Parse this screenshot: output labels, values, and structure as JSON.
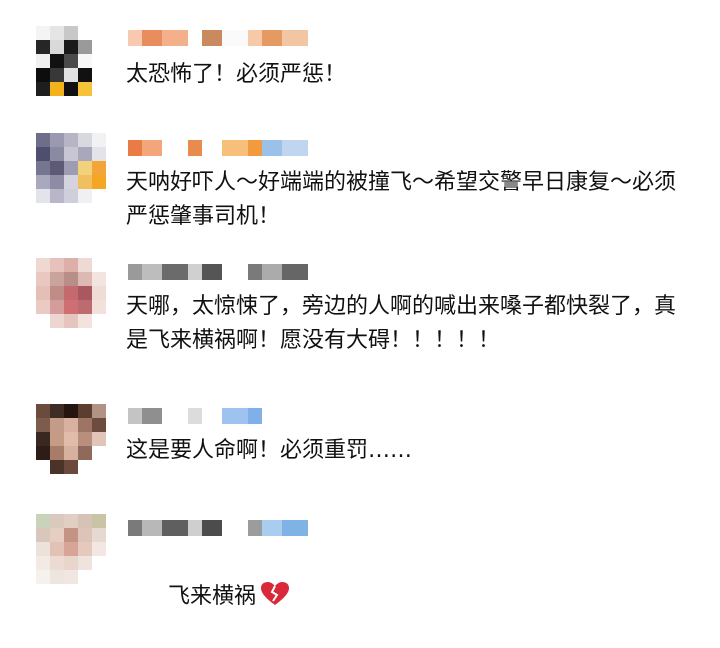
{
  "comments": [
    {
      "text": "太恐怖了！必须严惩！",
      "avatar_colors": [
        "#f4f4f4",
        "#e5e5e5",
        "#c8c8c8",
        "#ffffff",
        "#ffffff",
        "#262626",
        "#d9d9d9",
        "#1a1a1a",
        "#9a9a9a",
        "#ffffff",
        "#f0f0f0",
        "#111111",
        "#4a4a4a",
        "#f7f7f7",
        "#ffffff",
        "#0d0d0d",
        "#383838",
        "#e1e1e1",
        "#111111",
        "#ffffff",
        "#1e1e1e",
        "#f2b21c",
        "#111111",
        "#f5c33a",
        "#ffffff"
      ],
      "name_colors": [
        "#f6c9b0",
        "#e88d5e",
        "#f3b08a",
        "#ffffff",
        "#c98a60",
        "#fafafa",
        "#f7c9a8",
        "#e59a63",
        "#f2c6a3"
      ]
    },
    {
      "text": "天呐好吓人～好端端的被撞飞～希望交警早日康复～必须严惩肇事司机！",
      "avatar_colors": [
        "#6e6d8a",
        "#9a99b0",
        "#b7b5c5",
        "#d8d8df",
        "#f2f2f4",
        "#4f4e6e",
        "#8a8ba2",
        "#c7c6d2",
        "#a9a8bb",
        "#e3e3e9",
        "#777691",
        "#5c5a75",
        "#9d9cb3",
        "#f1d27a",
        "#f3a637",
        "#a9a9bd",
        "#8e8ca4",
        "#d5d4de",
        "#f0c060",
        "#f5a623",
        "#e3e3ea",
        "#b8b6c8",
        "#cfcedb",
        "#f0f0f3",
        "#ffffff"
      ],
      "name_colors": [
        "#e97c45",
        "#f4a67b",
        "#ffffff",
        "#e98b4c",
        "#ffffff",
        "#f6c07a",
        "#f19b3e",
        "#9bc1ea",
        "#c0d6f0"
      ]
    },
    {
      "text": "天哪，太惊悚了，旁边的人啊的喊出来嗓子都快裂了，真是飞来横祸啊！愿没有大碍！！！！！",
      "avatar_colors": [
        "#f0d8d2",
        "#e6c2ba",
        "#dcb0a8",
        "#efd9d4",
        "#ffffff",
        "#e8c8c0",
        "#caa39c",
        "#b88f88",
        "#dcbab3",
        "#f4e4e0",
        "#e4bfb6",
        "#c08c86",
        "#c46a6e",
        "#a95860",
        "#f0dcd7",
        "#e9cbc4",
        "#d49c9a",
        "#cf6e73",
        "#bd6b70",
        "#f2e0db",
        "#ffffff",
        "#eed6d0",
        "#e5c5be",
        "#f3e2de",
        "#ffffff"
      ],
      "name_colors": [
        "#9a9a9a",
        "#bdbdbd",
        "#6b6b6b",
        "#d0d0d0",
        "#555555",
        "#ffffff",
        "#7a7a7a",
        "#ababab",
        "#666666"
      ]
    },
    {
      "text": "这是要人命啊！必须重罚……",
      "avatar_colors": [
        "#6b4c3c",
        "#3f2c24",
        "#24160f",
        "#5a3e30",
        "#b29383",
        "#7e5c4b",
        "#c49a88",
        "#d8b1a1",
        "#9e7564",
        "#6d4c3e",
        "#3a2720",
        "#c69b86",
        "#e1bcaa",
        "#b78f7c",
        "#e0c5b8",
        "#2d1d16",
        "#a77c68",
        "#d7b19f",
        "#8f6a5a",
        "#ffffff",
        "#ffffff",
        "#4a3329",
        "#6b4a3d",
        "#ffffff",
        "#ffffff"
      ],
      "name_colors": [
        "#c4c4c4",
        "#8f8f8f",
        "#ffffff",
        "#dcdcdc",
        "#ffffff",
        "#9fc3ee",
        "#7fb0e8",
        "#ffffff",
        "#ffffff"
      ]
    },
    {
      "text": "飞来横祸",
      "avatar_colors": [
        "#c9d3ba",
        "#dcc9bd",
        "#e2cfc4",
        "#d7c2b6",
        "#c8c4a5",
        "#d9c7bc",
        "#e6cfc2",
        "#c39486",
        "#dcc4b9",
        "#e5d9d2",
        "#ece1db",
        "#e1c2b4",
        "#d7a596",
        "#e5c9bd",
        "#f2e7e2",
        "#f3eae6",
        "#ecdbd3",
        "#e8d5cb",
        "#efe3de",
        "#ffffff",
        "#f7f1ee",
        "#efe5e0",
        "#f1e6e1",
        "#ffffff",
        "#ffffff"
      ],
      "name_colors": [
        "#7a7a7a",
        "#b8b8b8",
        "#5f5f5f",
        "#cfcfcf",
        "#4c4c4c",
        "#ffffff",
        "#9c9c9c",
        "#a9cdee",
        "#7fb3e6"
      ]
    }
  ],
  "heart_color": "#d8283a"
}
